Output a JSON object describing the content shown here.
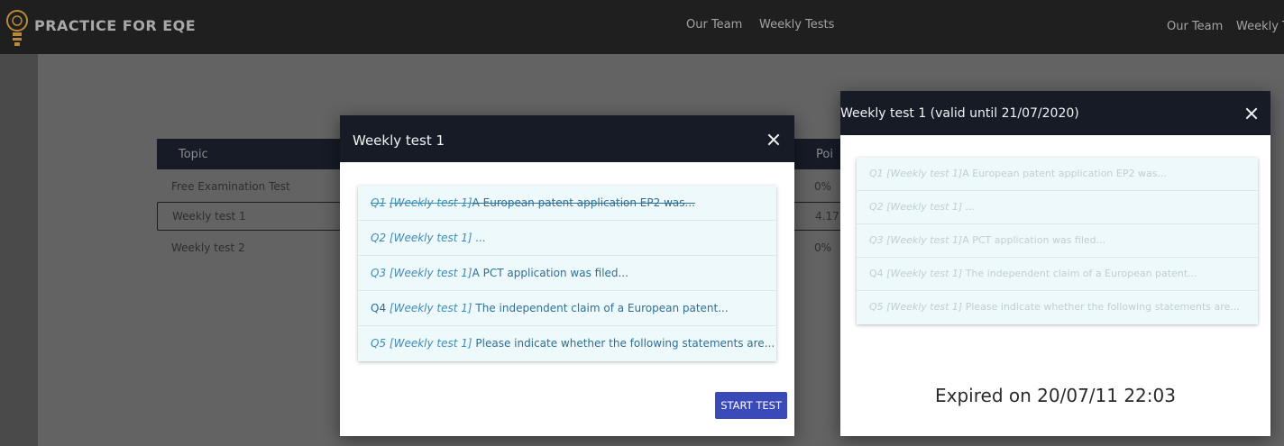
{
  "navbar": {
    "brand": "PRACTICE FOR EQE",
    "links": [
      "Our Team",
      "Weekly Tests"
    ],
    "edge_links": [
      "Our Team",
      "Weekly T"
    ]
  },
  "topic_table": {
    "headers": [
      "Topic",
      "Poi"
    ],
    "rows": [
      {
        "topic": "Free Examination Test",
        "points": "0%"
      },
      {
        "topic": "Weekly test 1",
        "points": "4.17"
      },
      {
        "topic": "Weekly test 2",
        "points": "0%"
      }
    ]
  },
  "modal_left": {
    "title": "Weekly test 1",
    "questions": [
      {
        "num": "Q1",
        "tag": "[Weekly test 1]",
        "text": "A European patent application EP2 was...",
        "done": true
      },
      {
        "num": "Q2",
        "tag": "[Weekly test 1]",
        "text": "...",
        "done": false
      },
      {
        "num": "Q3",
        "tag": "[Weekly test 1]",
        "text": "A PCT application was filed...",
        "done": false
      },
      {
        "num": "Q4",
        "tag": "[Weekly test 1]",
        "text": " The independent claim of a European patent...",
        "done": false
      },
      {
        "num": "Q5",
        "tag": "[Weekly test 1]",
        "text": " Please indicate whether the following statements are...",
        "done": false
      }
    ],
    "start_label": "START TEST"
  },
  "modal_right": {
    "title": "Weekly test 1 (valid until 21/07/2020)",
    "questions": [
      {
        "num": "Q1",
        "tag": "[Weekly test 1]",
        "text": "A European patent application EP2 was..."
      },
      {
        "num": "Q2",
        "tag": "[Weekly test 1]",
        "text": "..."
      },
      {
        "num": "Q3",
        "tag": "[Weekly test 1]",
        "text": "A PCT application was filed..."
      },
      {
        "num": "Q4",
        "tag": "[Weekly test 1]",
        "text": " The independent claim of a European patent..."
      },
      {
        "num": "Q5",
        "tag": "[Weekly test 1]",
        "text": " Please indicate whether the following statements are..."
      }
    ],
    "expired_text": "Expired on 20/07/11 22:03"
  },
  "colors": {
    "header_bg": "#161b26",
    "button_bg": "#3a4ab8",
    "question_bg": "#eef9fb"
  }
}
